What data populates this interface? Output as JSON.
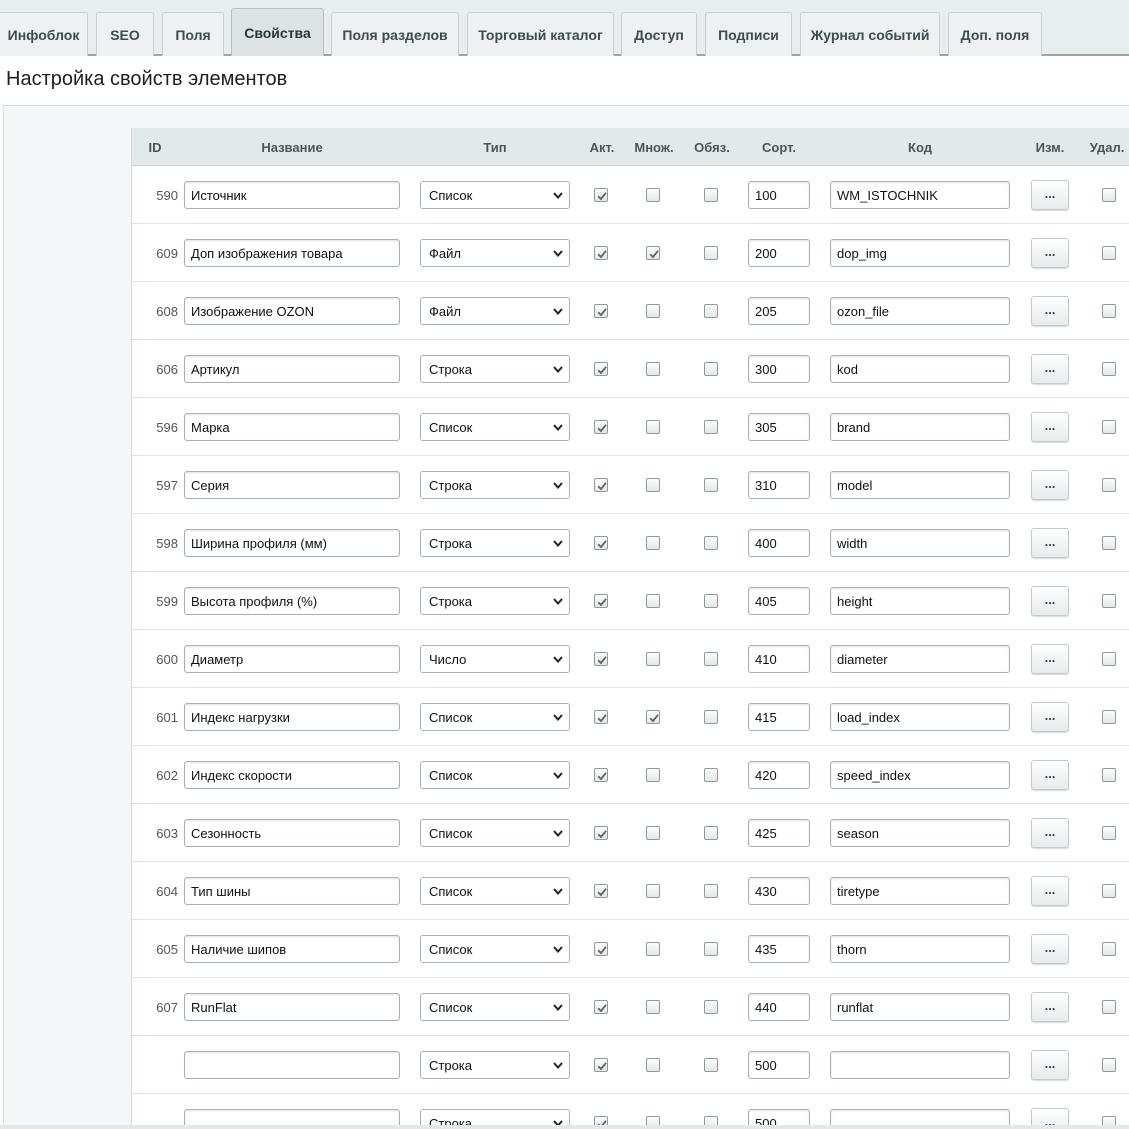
{
  "tabs": [
    {
      "label": "Инфоблок",
      "active": false
    },
    {
      "label": "SEO",
      "active": false
    },
    {
      "label": "Поля",
      "active": false
    },
    {
      "label": "Свойства",
      "active": true
    },
    {
      "label": "Поля разделов",
      "active": false
    },
    {
      "label": "Торговый каталог",
      "active": false
    },
    {
      "label": "Доступ",
      "active": false
    },
    {
      "label": "Подписи",
      "active": false
    },
    {
      "label": "Журнал событий",
      "active": false
    },
    {
      "label": "Доп. поля",
      "active": false
    }
  ],
  "page_title": "Настройка свойств элементов",
  "columns": {
    "id": "ID",
    "name": "Название",
    "type": "Тип",
    "active": "Акт.",
    "multiple": "Множ.",
    "required": "Обяз.",
    "sort": "Сорт.",
    "code": "Код",
    "edit": "Изм.",
    "delete": "Удал."
  },
  "edit_button_label": "...",
  "rows": [
    {
      "id": "590",
      "name": "Источник",
      "type": "Список",
      "active": true,
      "multiple": false,
      "required": false,
      "sort": "100",
      "code": "WM_ISTOCHNIK",
      "delete": false
    },
    {
      "id": "609",
      "name": "Доп изображения товара",
      "type": "Файл",
      "active": true,
      "multiple": true,
      "required": false,
      "sort": "200",
      "code": "dop_img",
      "delete": false
    },
    {
      "id": "608",
      "name": "Изображение OZON",
      "type": "Файл",
      "active": true,
      "multiple": false,
      "required": false,
      "sort": "205",
      "code": "ozon_file",
      "delete": false
    },
    {
      "id": "606",
      "name": "Артикул",
      "type": "Строка",
      "active": true,
      "multiple": false,
      "required": false,
      "sort": "300",
      "code": "kod",
      "delete": false
    },
    {
      "id": "596",
      "name": "Марка",
      "type": "Список",
      "active": true,
      "multiple": false,
      "required": false,
      "sort": "305",
      "code": "brand",
      "delete": false
    },
    {
      "id": "597",
      "name": "Серия",
      "type": "Строка",
      "active": true,
      "multiple": false,
      "required": false,
      "sort": "310",
      "code": "model",
      "delete": false
    },
    {
      "id": "598",
      "name": "Ширина профиля (мм)",
      "type": "Строка",
      "active": true,
      "multiple": false,
      "required": false,
      "sort": "400",
      "code": "width",
      "delete": false
    },
    {
      "id": "599",
      "name": "Высота профиля (%)",
      "type": "Строка",
      "active": true,
      "multiple": false,
      "required": false,
      "sort": "405",
      "code": "height",
      "delete": false
    },
    {
      "id": "600",
      "name": "Диаметр",
      "type": "Число",
      "active": true,
      "multiple": false,
      "required": false,
      "sort": "410",
      "code": "diameter",
      "delete": false
    },
    {
      "id": "601",
      "name": "Индекс нагрузки",
      "type": "Список",
      "active": true,
      "multiple": true,
      "required": false,
      "sort": "415",
      "code": "load_index",
      "delete": false
    },
    {
      "id": "602",
      "name": "Индекс скорости",
      "type": "Список",
      "active": true,
      "multiple": false,
      "required": false,
      "sort": "420",
      "code": "speed_index",
      "delete": false
    },
    {
      "id": "603",
      "name": "Сезонность",
      "type": "Список",
      "active": true,
      "multiple": false,
      "required": false,
      "sort": "425",
      "code": "season",
      "delete": false
    },
    {
      "id": "604",
      "name": "Тип шины",
      "type": "Список",
      "active": true,
      "multiple": false,
      "required": false,
      "sort": "430",
      "code": "tiretype",
      "delete": false
    },
    {
      "id": "605",
      "name": "Наличие шипов",
      "type": "Список",
      "active": true,
      "multiple": false,
      "required": false,
      "sort": "435",
      "code": "thorn",
      "delete": false
    },
    {
      "id": "607",
      "name": "RunFlat",
      "type": "Список",
      "active": true,
      "multiple": false,
      "required": false,
      "sort": "440",
      "code": "runflat",
      "delete": false
    },
    {
      "id": "",
      "name": "",
      "type": "Строка",
      "active": true,
      "multiple": false,
      "required": false,
      "sort": "500",
      "code": "",
      "delete": false
    },
    {
      "id": "",
      "name": "",
      "type": "Строка",
      "active": true,
      "multiple": false,
      "required": false,
      "sort": "500",
      "code": "",
      "delete": false
    }
  ]
}
